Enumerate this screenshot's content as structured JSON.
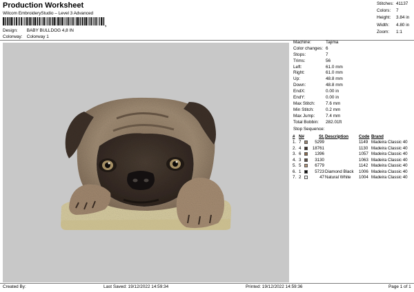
{
  "header": {
    "title": "Production Worksheet",
    "subtitle": "Wilcom EmbroideryStudio – Level 3 Advanced",
    "barcode_tick": ","
  },
  "meta": {
    "design_label": "Design:",
    "design_value": "BABY BULLDOG 4,8 IN",
    "colorway_label": "Colorway:",
    "colorway_value": "Colorway 1"
  },
  "summary": [
    {
      "label": "Stitches:",
      "value": "41137"
    },
    {
      "label": "Colors:",
      "value": "7"
    },
    {
      "label": "Height:",
      "value": "3.84 in"
    },
    {
      "label": "Width:",
      "value": "4.80 in"
    },
    {
      "label": "Zoom:",
      "value": "1:1"
    }
  ],
  "info": [
    {
      "label": "Machine:",
      "value": "Tajima"
    },
    {
      "label": "Color changes:",
      "value": "6"
    },
    {
      "label": "Stops:",
      "value": "7"
    },
    {
      "label": "Trims:",
      "value": "56"
    },
    {
      "label": "Left:",
      "value": "61.0 mm"
    },
    {
      "label": "Right:",
      "value": "61.0 mm"
    },
    {
      "label": "Up:",
      "value": "48.8 mm"
    },
    {
      "label": "Down:",
      "value": "48.8 mm"
    },
    {
      "label": "EndX:",
      "value": "0.00 in"
    },
    {
      "label": "EndY:",
      "value": "0.00 in"
    },
    {
      "label": "Max Stitch:",
      "value": "7.6 mm"
    },
    {
      "label": "Min Stitch:",
      "value": "0.2 mm"
    },
    {
      "label": "Max Jump:",
      "value": "7.4 mm"
    },
    {
      "label": "Total Bobbin:",
      "value": "282.01ft"
    }
  ],
  "stop_sequence": {
    "title": "Stop Sequence:",
    "headers": {
      "hash": "#",
      "n": "N#",
      "st": "St.",
      "desc": "Description",
      "code": "Code",
      "brand": "Brand"
    },
    "rows": [
      {
        "idx": "1.",
        "n": "7",
        "color": "#9a8472",
        "st": "5299",
        "desc": "",
        "code": "1149",
        "brand": "Madeira Classic 40"
      },
      {
        "idx": "2.",
        "n": "4",
        "color": "#3c2f2a",
        "st": "18761",
        "desc": "",
        "code": "1130",
        "brand": "Madeira Classic 40"
      },
      {
        "idx": "3.",
        "n": "6",
        "color": "#8a6a4c",
        "st": "1396",
        "desc": "",
        "code": "1057",
        "brand": "Madeira Classic 40"
      },
      {
        "idx": "4.",
        "n": "3",
        "color": "#5a4a40",
        "st": "3130",
        "desc": "",
        "code": "1063",
        "brand": "Madeira Classic 40"
      },
      {
        "idx": "5.",
        "n": "5",
        "color": "#b8977a",
        "st": "6779",
        "desc": "",
        "code": "1142",
        "brand": "Madeira Classic 40"
      },
      {
        "idx": "6.",
        "n": "1",
        "color": "#111111",
        "st": "5723",
        "desc": "Diamond Black",
        "code": "1006",
        "brand": "Madeira Classic 40"
      },
      {
        "idx": "7.",
        "n": "2",
        "color": "#f2f2f2",
        "st": "47",
        "desc": "Natural White",
        "code": "1004",
        "brand": "Madeira Classic 40"
      }
    ]
  },
  "footer": {
    "created": "Created By:",
    "saved": "Last Saved: 19/12/2022 14:59:34",
    "printed": "Printed: 19/12/2022 14:59:36",
    "page": "Page 1 of 1"
  },
  "colors": {
    "canvas_bg": "#c8c8c8",
    "fur_tan": "#9e8a72",
    "fur_dark": "#4a3b30",
    "cushion": "#d7cda4"
  }
}
